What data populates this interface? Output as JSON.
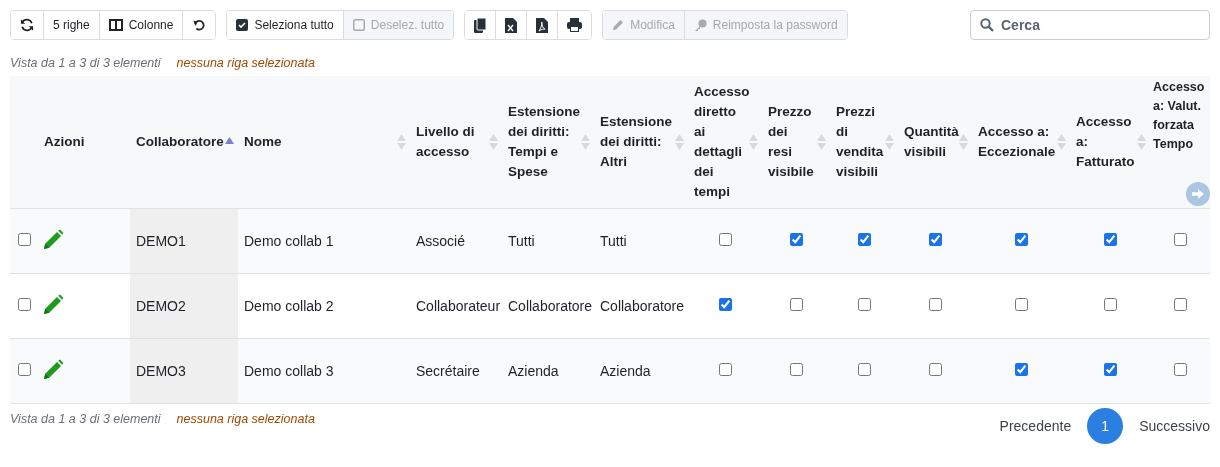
{
  "toolbar": {
    "groups": [
      {
        "buttons": [
          {
            "kind": "refresh",
            "disabled": false
          },
          {
            "kind": "page-size",
            "label": "5 righe",
            "disabled": false
          },
          {
            "kind": "columns",
            "label": "Colonne",
            "disabled": false
          },
          {
            "kind": "reset",
            "disabled": false
          }
        ]
      },
      {
        "buttons": [
          {
            "kind": "select-all",
            "label": "Seleziona tutto",
            "disabled": false
          },
          {
            "kind": "deselect-all",
            "label": "Deselez. tutto",
            "disabled": true
          }
        ]
      },
      {
        "buttons": [
          {
            "kind": "copy",
            "disabled": false
          },
          {
            "kind": "excel",
            "disabled": false
          },
          {
            "kind": "pdf",
            "disabled": false
          },
          {
            "kind": "print",
            "disabled": false
          }
        ]
      },
      {
        "buttons": [
          {
            "kind": "edit",
            "label": "Modifica",
            "disabled": true
          },
          {
            "kind": "password",
            "label": "Reimposta la password",
            "disabled": true
          }
        ]
      }
    ],
    "search": {
      "placeholder": "Cerca"
    }
  },
  "info_top": {
    "range": "Vista da 1 a 3 di 3 elementi",
    "selection": "nessuna riga selezionata"
  },
  "table": {
    "actions_column": {
      "label": "Azioni"
    },
    "columns": [
      {
        "label": "Collaboratore",
        "sortable": true,
        "sorted": true
      },
      {
        "label": "Nome",
        "sortable": true,
        "sorted": false
      },
      {
        "label": "Livello di accesso",
        "sortable": true,
        "sorted": false
      },
      {
        "label": "Estensione dei diritti: Tempi e Spese",
        "sortable": true,
        "sorted": false
      },
      {
        "label": "Estensione dei diritti: Altri",
        "sortable": true,
        "sorted": false
      },
      {
        "label": "Accesso diretto ai dettagli dei tempi",
        "sortable": true,
        "sorted": false
      },
      {
        "label": "Prezzo dei resi visibile",
        "sortable": true,
        "sorted": false
      },
      {
        "label": "Prezzi di vendita visibili",
        "sortable": true,
        "sorted": false
      },
      {
        "label": "Quantità visibili",
        "sortable": true,
        "sorted": false
      },
      {
        "label": "Accesso a: Eccezionale",
        "sortable": true,
        "sorted": false
      },
      {
        "label": "Accesso a: Fatturato",
        "sortable": true,
        "sorted": false
      },
      {
        "label": "Accesso a: Valut. forzata Tempo"
      }
    ],
    "rows": [
      {
        "selected": false,
        "cells": [
          "DEMO1",
          "Demo collab 1",
          "Associé",
          "Tutti",
          "Tutti"
        ],
        "flags": [
          false,
          true,
          true,
          true,
          true,
          true,
          false
        ]
      },
      {
        "selected": false,
        "cells": [
          "DEMO2",
          "Demo collab 2",
          "Collaborateur",
          "Collaboratore",
          "Collaboratore"
        ],
        "flags": [
          true,
          false,
          false,
          false,
          false,
          false,
          false
        ]
      },
      {
        "selected": false,
        "cells": [
          "DEMO3",
          "Demo collab 3",
          "Secrétaire",
          "Azienda",
          "Azienda"
        ],
        "flags": [
          false,
          false,
          false,
          false,
          true,
          true,
          false
        ]
      }
    ]
  },
  "info_bottom": {
    "range": "Vista da 1 a 3 di 3 elementi",
    "selection": "nessuna riga selezionata"
  },
  "pagination": {
    "previous": "Precedente",
    "pages": [
      {
        "label": "1",
        "selected": true
      }
    ],
    "next": "Successivo"
  }
}
